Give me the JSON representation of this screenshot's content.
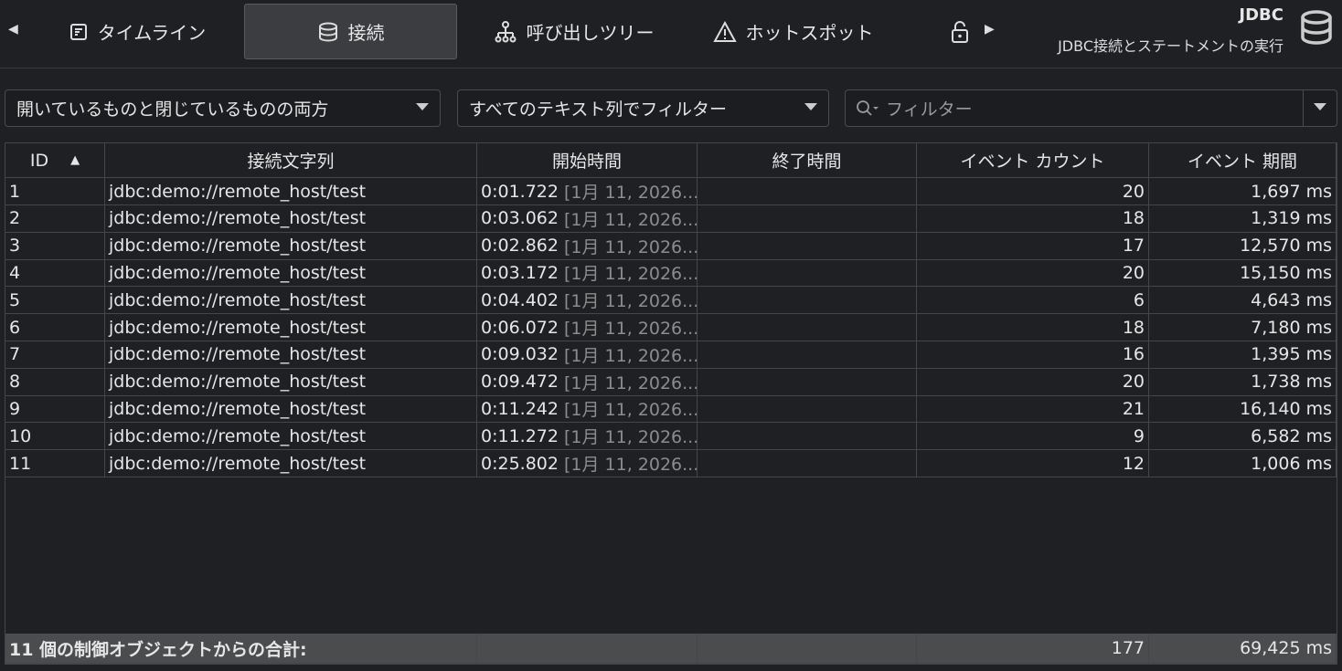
{
  "tabs": [
    {
      "label": "タイムライン",
      "icon": "timeline-icon"
    },
    {
      "label": "接続",
      "icon": "database-icon",
      "active": true
    },
    {
      "label": "呼び出しツリー",
      "icon": "call-tree-icon"
    },
    {
      "label": "ホットスポット",
      "icon": "warning-icon"
    },
    {
      "label": "",
      "icon": "lock-icon"
    }
  ],
  "header": {
    "title": "JDBC",
    "subtitle": "JDBC接続とステートメントの実行"
  },
  "filters": {
    "state": "開いているものと閉じているものの両方",
    "column": "すべてのテキスト列でフィルター",
    "search_placeholder": "フィルター"
  },
  "columns": [
    "ID",
    "接続文字列",
    "開始時間",
    "終了時間",
    "イベント カウント",
    "イベント 期間"
  ],
  "rows": [
    [
      "1",
      "jdbc:demo://remote_host/test",
      "0:01.722",
      "[1月 11, 2026...",
      "",
      "20",
      "1,697 ms"
    ],
    [
      "2",
      "jdbc:demo://remote_host/test",
      "0:03.062",
      "[1月 11, 2026...",
      "",
      "18",
      "1,319 ms"
    ],
    [
      "3",
      "jdbc:demo://remote_host/test",
      "0:02.862",
      "[1月 11, 2026...",
      "",
      "17",
      "12,570 ms"
    ],
    [
      "4",
      "jdbc:demo://remote_host/test",
      "0:03.172",
      "[1月 11, 2026...",
      "",
      "20",
      "15,150 ms"
    ],
    [
      "5",
      "jdbc:demo://remote_host/test",
      "0:04.402",
      "[1月 11, 2026...",
      "",
      "6",
      "4,643 ms"
    ],
    [
      "6",
      "jdbc:demo://remote_host/test",
      "0:06.072",
      "[1月 11, 2026...",
      "",
      "18",
      "7,180 ms"
    ],
    [
      "7",
      "jdbc:demo://remote_host/test",
      "0:09.032",
      "[1月 11, 2026...",
      "",
      "16",
      "1,395 ms"
    ],
    [
      "8",
      "jdbc:demo://remote_host/test",
      "0:09.472",
      "[1月 11, 2026...",
      "",
      "20",
      "1,738 ms"
    ],
    [
      "9",
      "jdbc:demo://remote_host/test",
      "0:11.242",
      "[1月 11, 2026...",
      "",
      "21",
      "16,140 ms"
    ],
    [
      "10",
      "jdbc:demo://remote_host/test",
      "0:11.272",
      "[1月 11, 2026...",
      "",
      "9",
      "6,582 ms"
    ],
    [
      "11",
      "jdbc:demo://remote_host/test",
      "0:25.802",
      "[1月 11, 2026...",
      "",
      "12",
      "1,006 ms"
    ]
  ],
  "footer": {
    "label": "11 個の制御オブジェクトからの合計:",
    "count": "177",
    "duration": "69,425 ms"
  }
}
